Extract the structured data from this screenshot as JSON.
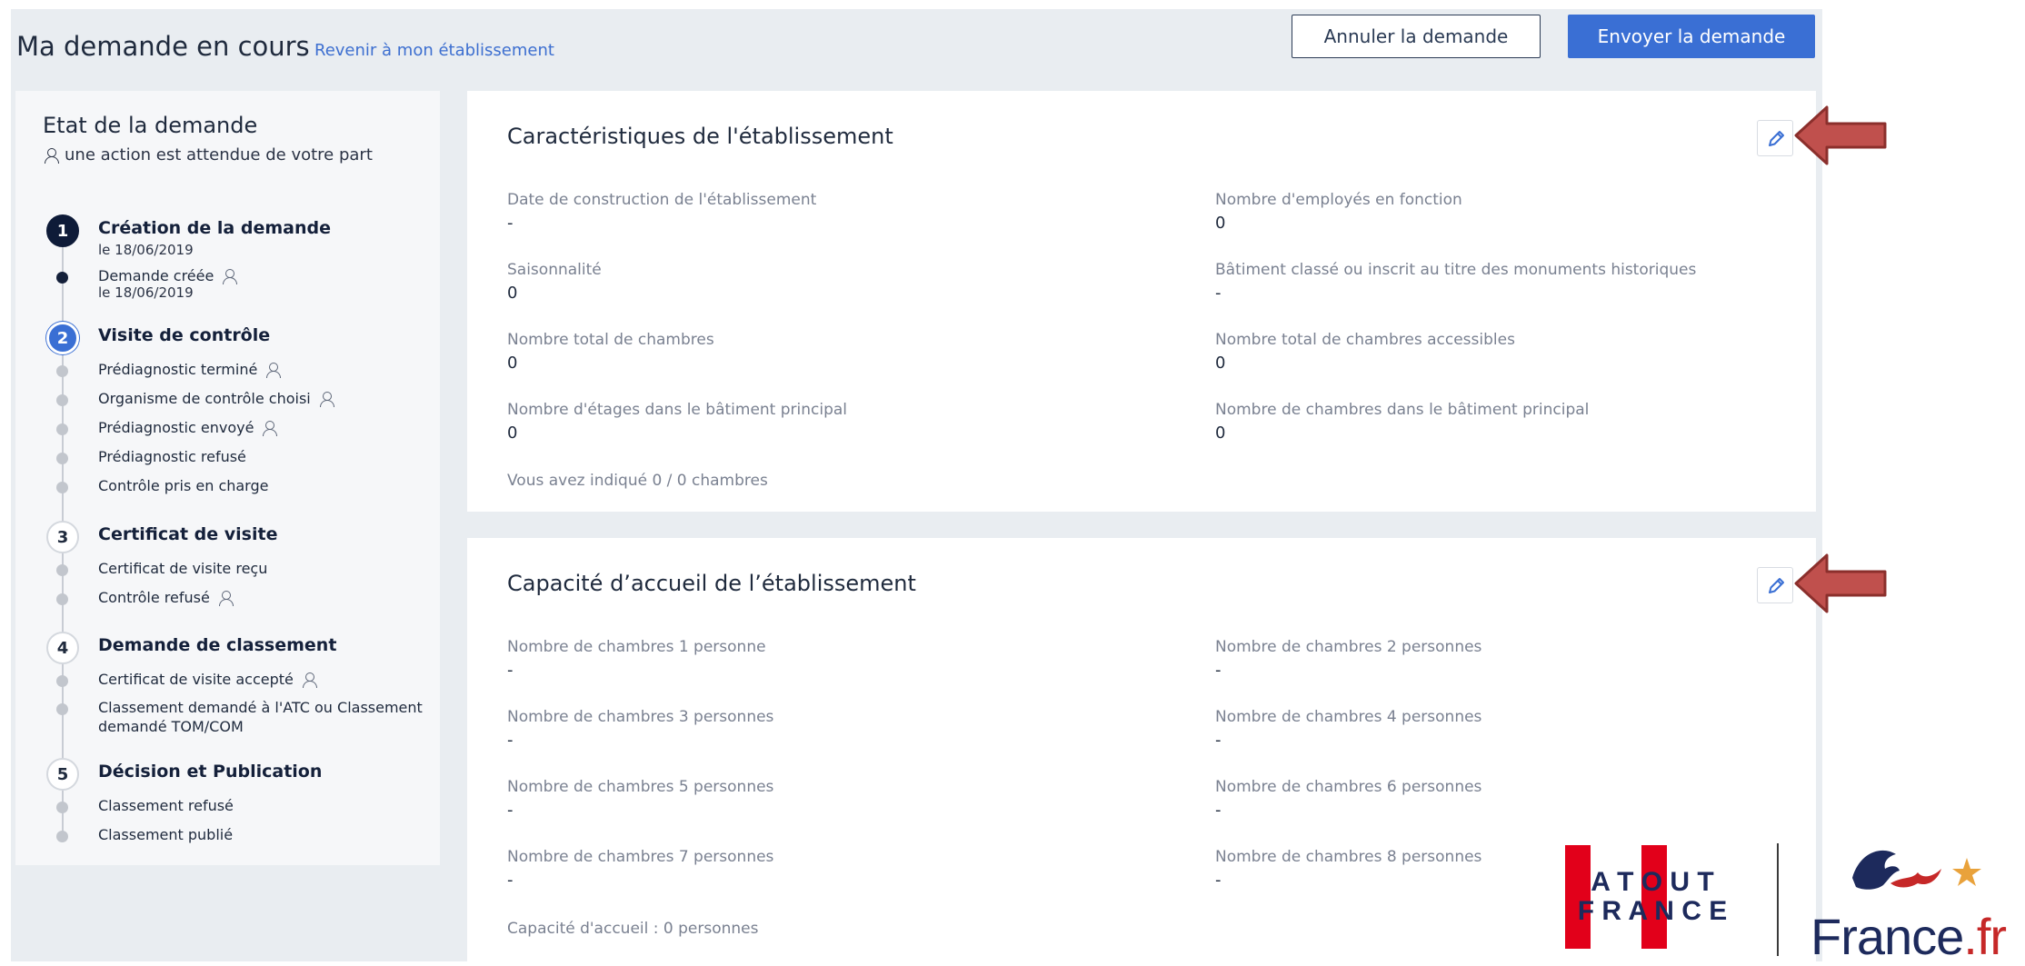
{
  "header": {
    "title": "Ma demande en cours",
    "back_link": "Revenir à mon établissement",
    "cancel_label": "Annuler la demande",
    "send_label": "Envoyer la demande"
  },
  "sidebar": {
    "title": "Etat de la demande",
    "subtitle": "une action est attendue de votre part",
    "steps": [
      {
        "number": "1",
        "title": "Création de la demande",
        "date": "le 18/06/2019",
        "items": [
          {
            "label": "Demande créée",
            "date": "le 18/06/2019"
          }
        ]
      },
      {
        "number": "2",
        "title": "Visite de contrôle",
        "items": [
          {
            "label": "Prédiagnostic terminé"
          },
          {
            "label": "Organisme de contrôle choisi"
          },
          {
            "label": "Prédiagnostic envoyé"
          },
          {
            "label": "Prédiagnostic refusé"
          },
          {
            "label": "Contrôle pris en charge"
          }
        ]
      },
      {
        "number": "3",
        "title": "Certificat de visite",
        "items": [
          {
            "label": "Certificat de visite reçu"
          },
          {
            "label": "Contrôle refusé"
          }
        ]
      },
      {
        "number": "4",
        "title": "Demande de classement",
        "items": [
          {
            "label": "Certificat de visite accepté"
          },
          {
            "label": "Classement demandé à l'ATC ou Classement demandé TOM/COM"
          }
        ]
      },
      {
        "number": "5",
        "title": "Décision et Publication",
        "items": [
          {
            "label": "Classement refusé"
          },
          {
            "label": "Classement publié"
          }
        ]
      }
    ]
  },
  "card_characteristics": {
    "title": "Caractéristiques de l'établissement",
    "fields": [
      {
        "label": "Date de construction de l'établissement",
        "value": "-"
      },
      {
        "label": "Nombre d'employés en fonction",
        "value": "0"
      },
      {
        "label": "Saisonnalité",
        "value": "0"
      },
      {
        "label": "Bâtiment classé ou inscrit au titre des monuments historiques",
        "value": "-"
      },
      {
        "label": "Nombre total de chambres",
        "value": "0"
      },
      {
        "label": "Nombre total de chambres accessibles",
        "value": "0"
      },
      {
        "label": "Nombre d'étages dans le bâtiment principal",
        "value": "0"
      },
      {
        "label": "Nombre de chambres dans le bâtiment principal",
        "value": "0"
      }
    ],
    "note": "Vous avez indiqué 0 / 0 chambres"
  },
  "card_capacity": {
    "title": "Capacité d’accueil de l’établissement",
    "fields": [
      {
        "label": "Nombre de chambres 1 personne",
        "value": "-"
      },
      {
        "label": "Nombre de chambres 2 personnes",
        "value": "-"
      },
      {
        "label": "Nombre de chambres 3 personnes",
        "value": "-"
      },
      {
        "label": "Nombre de chambres 4 personnes",
        "value": "-"
      },
      {
        "label": "Nombre de chambres 5 personnes",
        "value": "-"
      },
      {
        "label": "Nombre de chambres 6 personnes",
        "value": "-"
      },
      {
        "label": "Nombre de chambres 7 personnes",
        "value": "-"
      },
      {
        "label": "Nombre de chambres 8 personnes",
        "value": "-"
      }
    ],
    "note": "Capacité d'accueil : 0 personnes"
  },
  "logos": {
    "atout_line1": "A T O U T",
    "atout_line2": "F R A N C E",
    "francefr_main": "France",
    "francefr_ext": ".fr"
  },
  "icons": {
    "edit": "pencil-icon",
    "person": "person-icon",
    "annotation": "red-arrow-icon"
  },
  "colors": {
    "primary": "#3a6fd4",
    "dark": "#0e1b38",
    "arrow": "#c0504d",
    "atout_red": "#e2001a"
  }
}
